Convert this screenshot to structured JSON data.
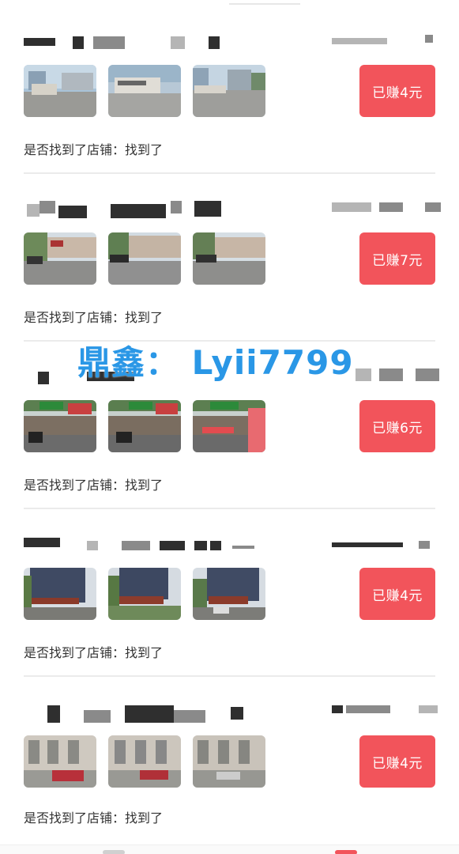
{
  "watermark": "鼎鑫： Lyii7799",
  "question_label": "是否找到了店铺：",
  "tasks": [
    {
      "answer": "找到了",
      "reward": "已赚4元"
    },
    {
      "answer": "找到了",
      "reward": "已赚7元"
    },
    {
      "answer": "找到了",
      "reward": "已赚6元"
    },
    {
      "answer": "找到了",
      "reward": "已赚4元"
    },
    {
      "answer": "找到了",
      "reward": "已赚4元"
    }
  ],
  "colors": {
    "reward_button": "#f2545b",
    "watermark": "#2a97e6",
    "text": "#333333"
  },
  "icons": [
    "store-photo-thumbnail"
  ]
}
